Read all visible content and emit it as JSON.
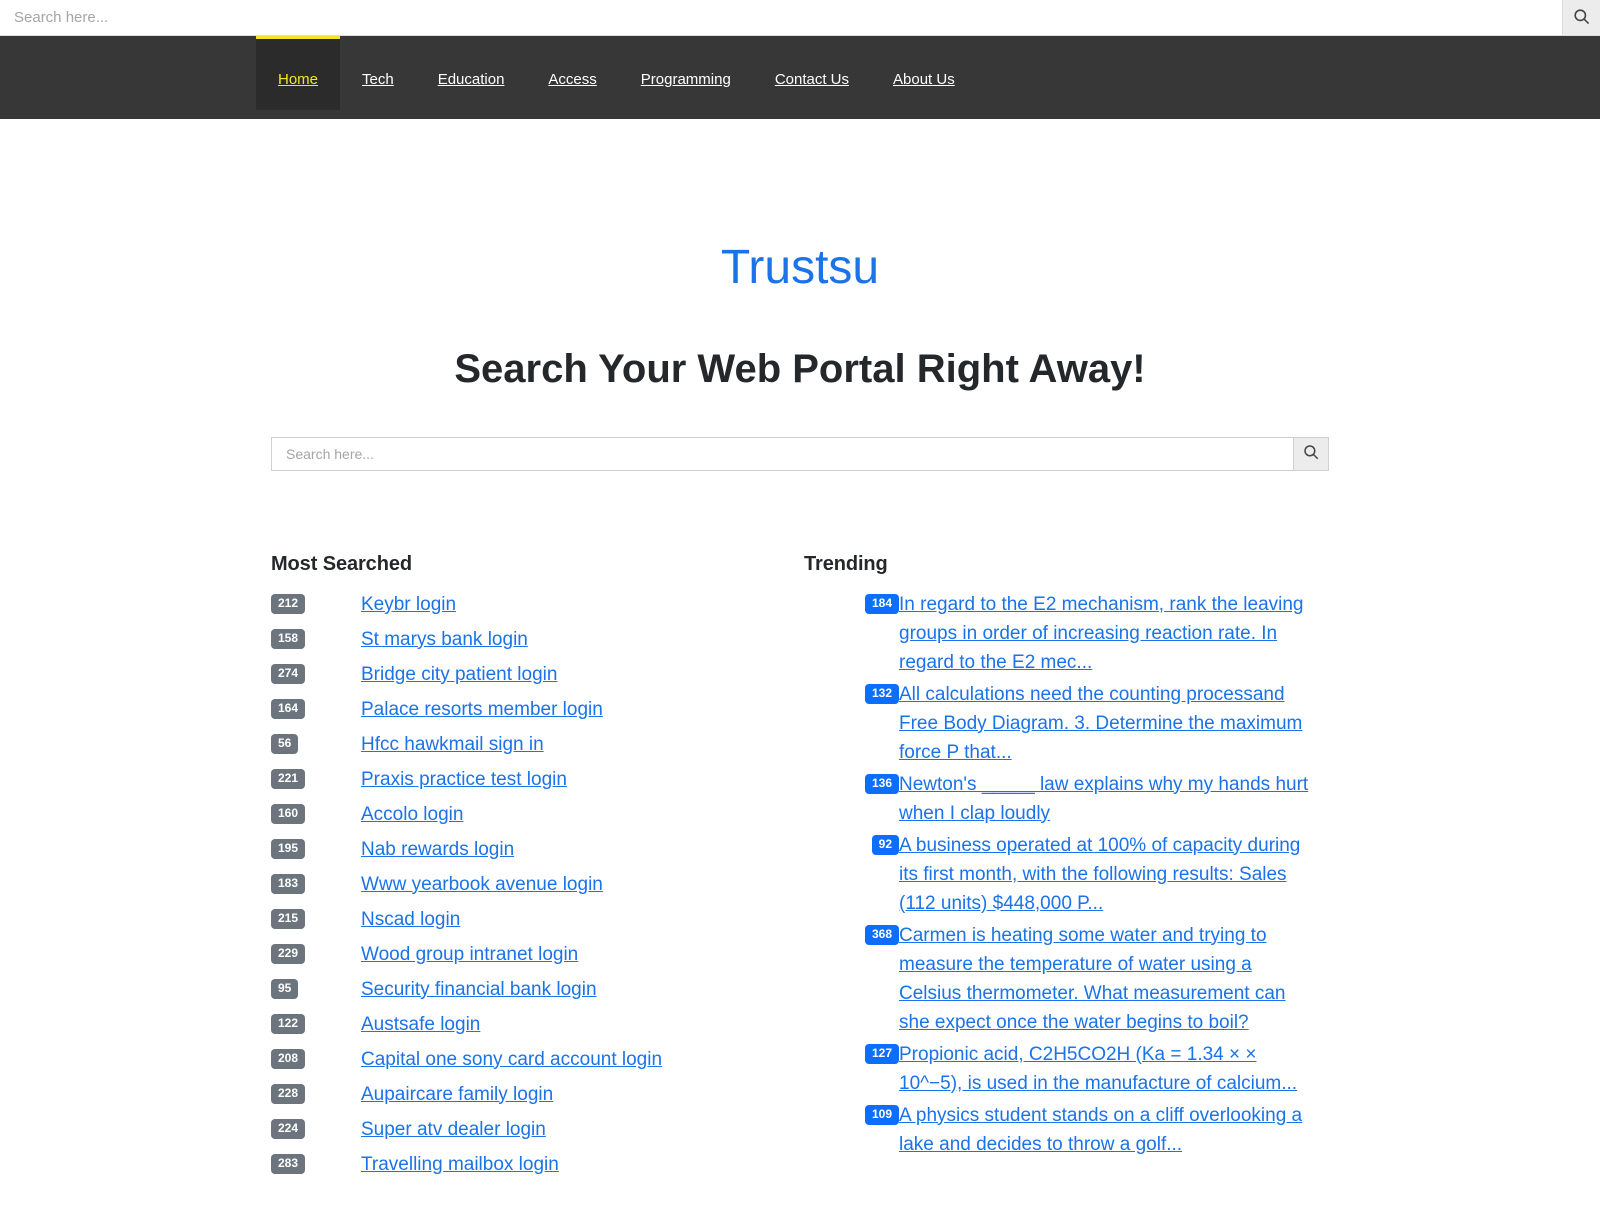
{
  "top_search": {
    "placeholder": "Search here...",
    "value": "",
    "button_icon": "search-icon"
  },
  "nav": {
    "items": [
      {
        "label": "Home",
        "active": true
      },
      {
        "label": "Tech",
        "active": false
      },
      {
        "label": "Education",
        "active": false
      },
      {
        "label": "Access",
        "active": false
      },
      {
        "label": "Programming",
        "active": false
      },
      {
        "label": "Contact Us",
        "active": false
      },
      {
        "label": "About Us",
        "active": false
      }
    ]
  },
  "hero": {
    "brand": "Trustsu",
    "heading": "Search Your Web Portal Right Away!"
  },
  "main_search": {
    "placeholder": "Search here...",
    "value": "",
    "button_icon": "search-icon"
  },
  "most_searched": {
    "heading": "Most Searched",
    "items": [
      {
        "count": "212",
        "label": "Keybr login"
      },
      {
        "count": "158",
        "label": "St marys bank login"
      },
      {
        "count": "274",
        "label": "Bridge city patient login"
      },
      {
        "count": "164",
        "label": "Palace resorts member login"
      },
      {
        "count": "56",
        "label": "Hfcc hawkmail sign in"
      },
      {
        "count": "221",
        "label": "Praxis practice test login"
      },
      {
        "count": "160",
        "label": "Accolo login"
      },
      {
        "count": "195",
        "label": "Nab rewards login"
      },
      {
        "count": "183",
        "label": "Www yearbook avenue login"
      },
      {
        "count": "215",
        "label": "Nscad login"
      },
      {
        "count": "229",
        "label": "Wood group intranet login"
      },
      {
        "count": "95",
        "label": "Security financial bank login"
      },
      {
        "count": "122",
        "label": "Austsafe login"
      },
      {
        "count": "208",
        "label": "Capital one sony card account login"
      },
      {
        "count": "228",
        "label": "Aupaircare family login"
      },
      {
        "count": "224",
        "label": "Super atv dealer login"
      },
      {
        "count": "283",
        "label": "Travelling mailbox login"
      }
    ]
  },
  "trending": {
    "heading": "Trending",
    "items": [
      {
        "count": "184",
        "label": "In regard to the E2 mechanism, rank the leaving groups in order of increasing reaction rate. In regard to the E2 mec..."
      },
      {
        "count": "132",
        "label": "All calculations need the counting processand Free Body Diagram. 3. Determine the maximum force P that..."
      },
      {
        "count": "136",
        "label": "Newton's _____ law explains why my hands hurt when I clap loudly"
      },
      {
        "count": "92",
        "label": "A business operated at 100% of capacity during its first month, with the following results: Sales (112 units) $448,000 P..."
      },
      {
        "count": "368",
        "label": "Carmen is heating some water and trying to measure the temperature of water using a Celsius thermometer. What measurement can she expect once the water begins to boil?"
      },
      {
        "count": "127",
        "label": "Propionic acid, C2H5CO2H (Ka = 1.34 × × 10^−5), is used in the manufacture of calcium..."
      },
      {
        "count": "109",
        "label": "A physics student stands on a cliff overlooking a lake and decides to throw a golf..."
      }
    ]
  },
  "colors": {
    "brand_blue": "#1a73e8",
    "nav_background": "#373737",
    "nav_active_text": "#f5e327",
    "badge_gray": "#6c757d",
    "badge_blue": "#0d6efd",
    "link_blue": "#1a73e8"
  }
}
